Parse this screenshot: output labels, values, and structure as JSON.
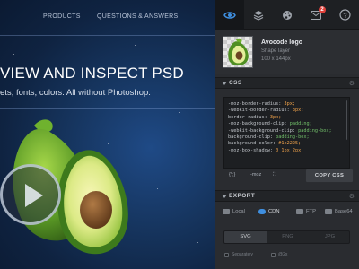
{
  "nav": {
    "items": [
      {
        "label": "PRODUCTS"
      },
      {
        "label": "QUESTIONS & ANSWERS"
      }
    ]
  },
  "hero": {
    "headline": "VIEW AND INSPECT PSD",
    "tagline": "ets, fonts, colors. All without Photoshop."
  },
  "toolbar": {
    "tools": [
      {
        "icon": "eye-icon",
        "active": true
      },
      {
        "icon": "layers-icon",
        "active": false
      },
      {
        "icon": "palette-icon",
        "active": false
      },
      {
        "icon": "notifications-icon",
        "active": false,
        "badge": "2"
      },
      {
        "icon": "help-icon",
        "active": false,
        "glyph": "?"
      }
    ]
  },
  "layer": {
    "name": "Avocode logo",
    "type": "Shape layer",
    "size": "100 x 144px"
  },
  "css_section": {
    "title": "CSS",
    "code": [
      {
        "prop": "-moz-border-radius:",
        "val": " 3px;",
        "tone": "val"
      },
      {
        "prop": "-webkit-border-radius:",
        "val": " 3px;",
        "tone": "val"
      },
      {
        "prop": "border-radius:",
        "val": " 3px;",
        "tone": "val"
      },
      {
        "prop": "-moz-background-clip:",
        "val": " padding;",
        "tone": "val2"
      },
      {
        "prop": "-webkit-background-clip:",
        "val": " padding-box;",
        "tone": "val2"
      },
      {
        "prop": "background-clip:",
        "val": " padding-box;",
        "tone": "val2"
      },
      {
        "prop": "background-color:",
        "val": " #1e2225;",
        "tone": "val"
      },
      {
        "prop": "-moz-box-shadow:",
        "val": " 0 1px 2px",
        "tone": "val"
      }
    ],
    "tools": [
      {
        "label": "{*;}"
      },
      {
        "label": "-moz"
      },
      {
        "label": "⛶"
      }
    ],
    "copy_label": "COPY CSS"
  },
  "export_section": {
    "title": "EXPORT",
    "formats": [
      {
        "label": "Local",
        "color": "#7d8289"
      },
      {
        "label": "CDN",
        "color": "#3f8fe0"
      },
      {
        "label": "FTP",
        "color": "#7d8289"
      },
      {
        "label": "Base64",
        "color": "#7d8289"
      }
    ],
    "file_types": [
      {
        "label": "SVG",
        "active": true
      },
      {
        "label": "PNG",
        "active": false
      },
      {
        "label": "JPG",
        "active": false
      }
    ],
    "options": [
      {
        "label": "Separately"
      },
      {
        "label": "@2x"
      }
    ]
  },
  "colors": {
    "accent": "#3f8fe0",
    "badge": "#e0413b",
    "panel_bg": "#2a2c30"
  }
}
